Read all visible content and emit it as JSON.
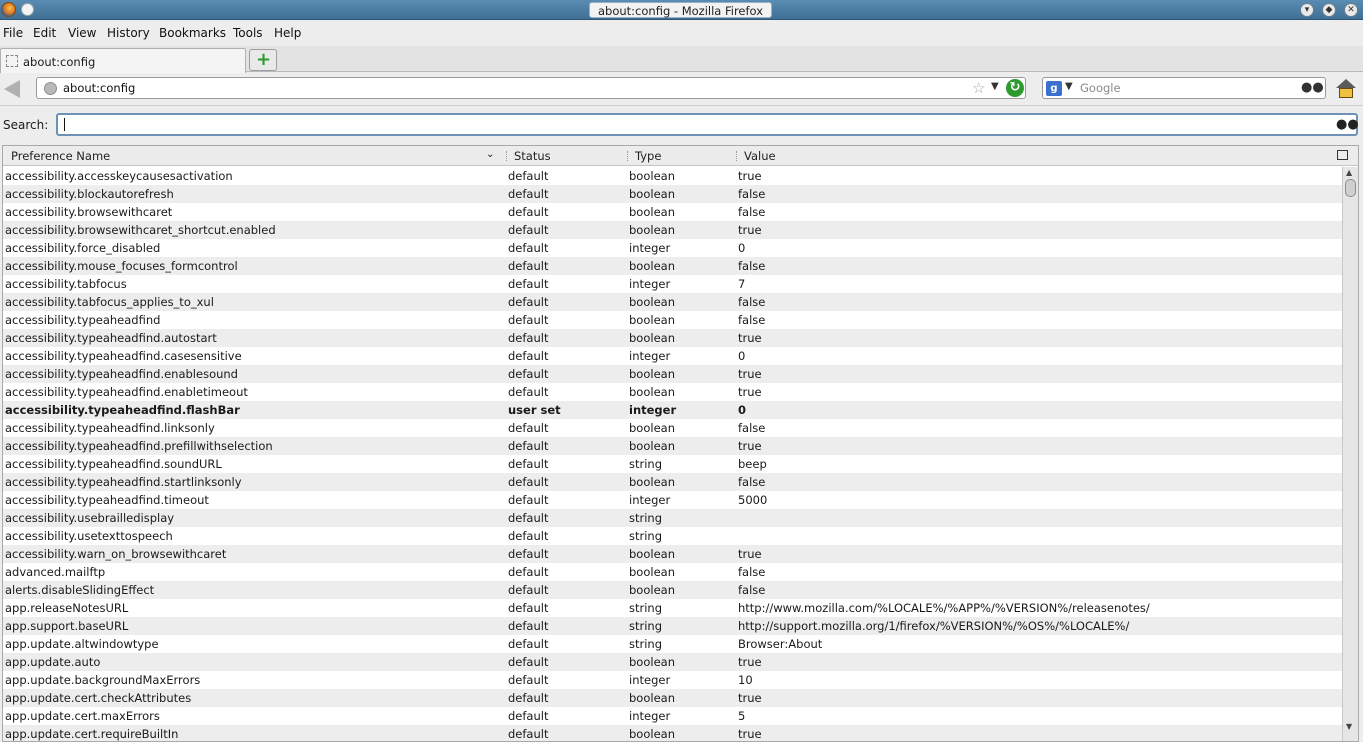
{
  "window": {
    "title": "about:config - Mozilla Firefox"
  },
  "menu": [
    "File",
    "Edit",
    "View",
    "History",
    "Bookmarks",
    "Tools",
    "Help"
  ],
  "tab": {
    "label": "about:config"
  },
  "newtab_label": "+",
  "urlbar": {
    "url": "about:config"
  },
  "search_engine": {
    "placeholder": "Google"
  },
  "search": {
    "label": "Search:",
    "value": ""
  },
  "columns": {
    "name": "Preference Name",
    "status": "Status",
    "type": "Type",
    "value": "Value"
  },
  "rows": [
    {
      "name": "accessibility.accesskeycausesactivation",
      "status": "default",
      "type": "boolean",
      "value": "true"
    },
    {
      "name": "accessibility.blockautorefresh",
      "status": "default",
      "type": "boolean",
      "value": "false"
    },
    {
      "name": "accessibility.browsewithcaret",
      "status": "default",
      "type": "boolean",
      "value": "false"
    },
    {
      "name": "accessibility.browsewithcaret_shortcut.enabled",
      "status": "default",
      "type": "boolean",
      "value": "true"
    },
    {
      "name": "accessibility.force_disabled",
      "status": "default",
      "type": "integer",
      "value": "0"
    },
    {
      "name": "accessibility.mouse_focuses_formcontrol",
      "status": "default",
      "type": "boolean",
      "value": "false"
    },
    {
      "name": "accessibility.tabfocus",
      "status": "default",
      "type": "integer",
      "value": "7"
    },
    {
      "name": "accessibility.tabfocus_applies_to_xul",
      "status": "default",
      "type": "boolean",
      "value": "false"
    },
    {
      "name": "accessibility.typeaheadfind",
      "status": "default",
      "type": "boolean",
      "value": "false"
    },
    {
      "name": "accessibility.typeaheadfind.autostart",
      "status": "default",
      "type": "boolean",
      "value": "true"
    },
    {
      "name": "accessibility.typeaheadfind.casesensitive",
      "status": "default",
      "type": "integer",
      "value": "0"
    },
    {
      "name": "accessibility.typeaheadfind.enablesound",
      "status": "default",
      "type": "boolean",
      "value": "true"
    },
    {
      "name": "accessibility.typeaheadfind.enabletimeout",
      "status": "default",
      "type": "boolean",
      "value": "true"
    },
    {
      "name": "accessibility.typeaheadfind.flashBar",
      "status": "user set",
      "type": "integer",
      "value": "0",
      "userset": true
    },
    {
      "name": "accessibility.typeaheadfind.linksonly",
      "status": "default",
      "type": "boolean",
      "value": "false"
    },
    {
      "name": "accessibility.typeaheadfind.prefillwithselection",
      "status": "default",
      "type": "boolean",
      "value": "true"
    },
    {
      "name": "accessibility.typeaheadfind.soundURL",
      "status": "default",
      "type": "string",
      "value": "beep"
    },
    {
      "name": "accessibility.typeaheadfind.startlinksonly",
      "status": "default",
      "type": "boolean",
      "value": "false"
    },
    {
      "name": "accessibility.typeaheadfind.timeout",
      "status": "default",
      "type": "integer",
      "value": "5000"
    },
    {
      "name": "accessibility.usebrailledisplay",
      "status": "default",
      "type": "string",
      "value": ""
    },
    {
      "name": "accessibility.usetexttospeech",
      "status": "default",
      "type": "string",
      "value": ""
    },
    {
      "name": "accessibility.warn_on_browsewithcaret",
      "status": "default",
      "type": "boolean",
      "value": "true"
    },
    {
      "name": "advanced.mailftp",
      "status": "default",
      "type": "boolean",
      "value": "false"
    },
    {
      "name": "alerts.disableSlidingEffect",
      "status": "default",
      "type": "boolean",
      "value": "false"
    },
    {
      "name": "app.releaseNotesURL",
      "status": "default",
      "type": "string",
      "value": "http://www.mozilla.com/%LOCALE%/%APP%/%VERSION%/releasenotes/"
    },
    {
      "name": "app.support.baseURL",
      "status": "default",
      "type": "string",
      "value": "http://support.mozilla.org/1/firefox/%VERSION%/%OS%/%LOCALE%/"
    },
    {
      "name": "app.update.altwindowtype",
      "status": "default",
      "type": "string",
      "value": "Browser:About"
    },
    {
      "name": "app.update.auto",
      "status": "default",
      "type": "boolean",
      "value": "true"
    },
    {
      "name": "app.update.backgroundMaxErrors",
      "status": "default",
      "type": "integer",
      "value": "10"
    },
    {
      "name": "app.update.cert.checkAttributes",
      "status": "default",
      "type": "boolean",
      "value": "true"
    },
    {
      "name": "app.update.cert.maxErrors",
      "status": "default",
      "type": "integer",
      "value": "5"
    },
    {
      "name": "app.update.cert.requireBuiltIn",
      "status": "default",
      "type": "boolean",
      "value": "true"
    }
  ]
}
